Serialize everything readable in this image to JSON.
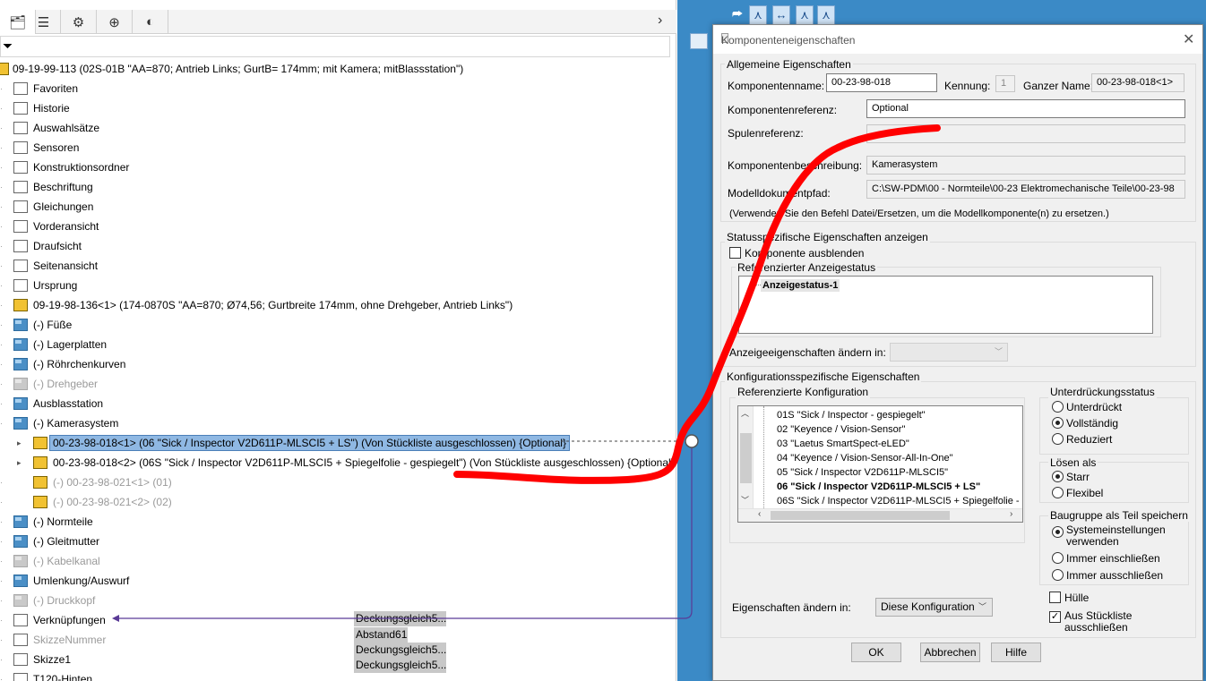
{
  "tree": {
    "root_label": "09-19-99-113 (02S-01B \"AA=870; Antrieb Links; GurtB= 174mm; mit Kamera; mitBlassstation\")",
    "items": [
      {
        "label": "Favoriten",
        "icon": "favorites-icon"
      },
      {
        "label": "Historie",
        "icon": "history-icon"
      },
      {
        "label": "Auswahlsätze",
        "icon": "selection-sets-icon"
      },
      {
        "label": "Sensoren",
        "icon": "sensor-icon"
      },
      {
        "label": "Konstruktionsordner",
        "icon": "design-folder-icon"
      },
      {
        "label": "Beschriftung",
        "icon": "annotation-icon"
      },
      {
        "label": "Gleichungen",
        "icon": "equations-icon"
      },
      {
        "label": "Vorderansicht",
        "icon": "plane-icon"
      },
      {
        "label": "Draufsicht",
        "icon": "plane-icon"
      },
      {
        "label": "Seitenansicht",
        "icon": "plane-icon"
      },
      {
        "label": "Ursprung",
        "icon": "origin-icon"
      },
      {
        "label": "09-19-98-136<1> (174-0870S \"AA=870; Ø74,56; Gurtbreite 174mm, ohne Drehgeber, Antrieb Links\")",
        "icon": "subassembly-icon"
      },
      {
        "label": "(-) Füße",
        "icon": "folder-icon"
      },
      {
        "label": "(-) Lagerplatten",
        "icon": "folder-icon"
      },
      {
        "label": "(-) Röhrchenkurven",
        "icon": "folder-icon"
      },
      {
        "label": "(-) Drehgeber",
        "icon": "folder-icon"
      },
      {
        "label": "Ausblasstation",
        "icon": "folder-icon"
      },
      {
        "label": "(-) Kamerasystem",
        "icon": "folder-icon"
      },
      {
        "label": "00-23-98-018<1> (06 \"Sick / Inspector V2D611P-MLSCI5 + LS\") (Von Stückliste ausgeschlossen) {Optional}",
        "icon": "component-icon"
      },
      {
        "label": "00-23-98-018<2> (06S \"Sick / Inspector V2D611P-MLSCI5 + Spiegelfolie - gespiegelt\") (Von Stückliste ausgeschlossen) {Optional}",
        "icon": "component-icon"
      },
      {
        "label": "(-) 00-23-98-021<1> (01)",
        "icon": "suppressed-component-icon"
      },
      {
        "label": "(-) 00-23-98-021<2> (02)",
        "icon": "suppressed-component-icon"
      },
      {
        "label": "(-) Normteile",
        "icon": "folder-icon"
      },
      {
        "label": "(-) Gleitmutter",
        "icon": "folder-icon"
      },
      {
        "label": "(-) Kabelkanal",
        "icon": "folder-icon"
      },
      {
        "label": "Umlenkung/Auswurf",
        "icon": "folder-icon"
      },
      {
        "label": "(-) Druckkopf",
        "icon": "folder-icon"
      },
      {
        "label": "Verknüpfungen",
        "icon": "mates-icon"
      },
      {
        "label": "SkizzeNummer",
        "icon": "sketch-icon"
      },
      {
        "label": "Skizze1",
        "icon": "sketch-icon"
      },
      {
        "label": "T120-Hinten",
        "icon": "sketch-icon"
      }
    ],
    "mates": [
      "Deckungsgleich5...",
      "Abstand61",
      "Deckungsgleich5...",
      "Deckungsgleich5..."
    ]
  },
  "dialog": {
    "title": "Komponenteneigenschaften",
    "general": {
      "group_label": "Allgemeine Eigenschaften",
      "name_label": "Komponentenname:",
      "name_value": "00-23-98-018",
      "id_label": "Kennung:",
      "id_value": "1",
      "fullname_label": "Ganzer Name:",
      "fullname_value": "00-23-98-018<1>",
      "ref_label": "Komponentenreferenz:",
      "ref_value": "Optional",
      "spool_label": "Spulenreferenz:",
      "desc_label": "Komponentenbeschreibung:",
      "desc_value": "Kamerasystem",
      "path_label": "Modelldokumentpfad:",
      "path_value": "C:\\SW-PDM\\00 - Normteile\\00-23 Elektromechanische Teile\\00-23-98",
      "hint": "(Verwenden Sie den Befehl Datei/Ersetzen, um die Modellkomponente(n) zu ersetzen.)"
    },
    "display": {
      "group_label": "Statusspezifische Eigenschaften anzeigen",
      "hide_label": "Komponente ausblenden",
      "ref_state_label": "Referenzierter Anzeigestatus",
      "state_item": "Anzeigestatus-1",
      "change_label": "Anzeigeeigenschaften ändern in:"
    },
    "config": {
      "group_label": "Konfigurationsspezifische Eigenschaften",
      "ref_label": "Referenzierte Konfiguration",
      "items": [
        {
          "label": "01S \"Sick / Inspector - gespiegelt\"",
          "bold": false
        },
        {
          "label": "02 \"Keyence / Vision-Sensor\"",
          "bold": false
        },
        {
          "label": "03 \"Laetus SmartSpect-eLED\"",
          "bold": false
        },
        {
          "label": "04 \"Keyence / Vision-Sensor-All-In-One\"",
          "bold": false
        },
        {
          "label": "05 \"Sick / Inspector V2D611P-MLSCI5\"",
          "bold": false
        },
        {
          "label": "06 \"Sick / Inspector V2D611P-MLSCI5 + LS\"",
          "bold": true
        },
        {
          "label": "06S \"Sick / Inspector V2D611P-MLSCI5 + Spiegelfolie -",
          "bold": false
        }
      ],
      "suppression_label": "Unterdrückungsstatus",
      "suppression_options": [
        "Unterdrückt",
        "Vollständig",
        "Reduziert"
      ],
      "solve_label": "Lösen als",
      "solve_options": [
        "Starr",
        "Flexibel"
      ],
      "save_label": "Baugruppe als Teil speichern",
      "save_options": [
        "Systemeinstellungen verwenden",
        "Immer einschließen",
        "Immer ausschließen"
      ],
      "change_label": "Eigenschaften ändern in:",
      "change_value": "Diese Konfiguration",
      "envelope_label": "Hülle",
      "exclude_bom_label": "Aus Stückliste ausschließen"
    },
    "buttons": {
      "ok": "OK",
      "cancel": "Abbrechen",
      "help": "Hilfe"
    }
  },
  "colors": {
    "selection": "#8fb8e3",
    "annotation_red": "#ff0000",
    "viewport_blue": "#3b8ac6"
  }
}
